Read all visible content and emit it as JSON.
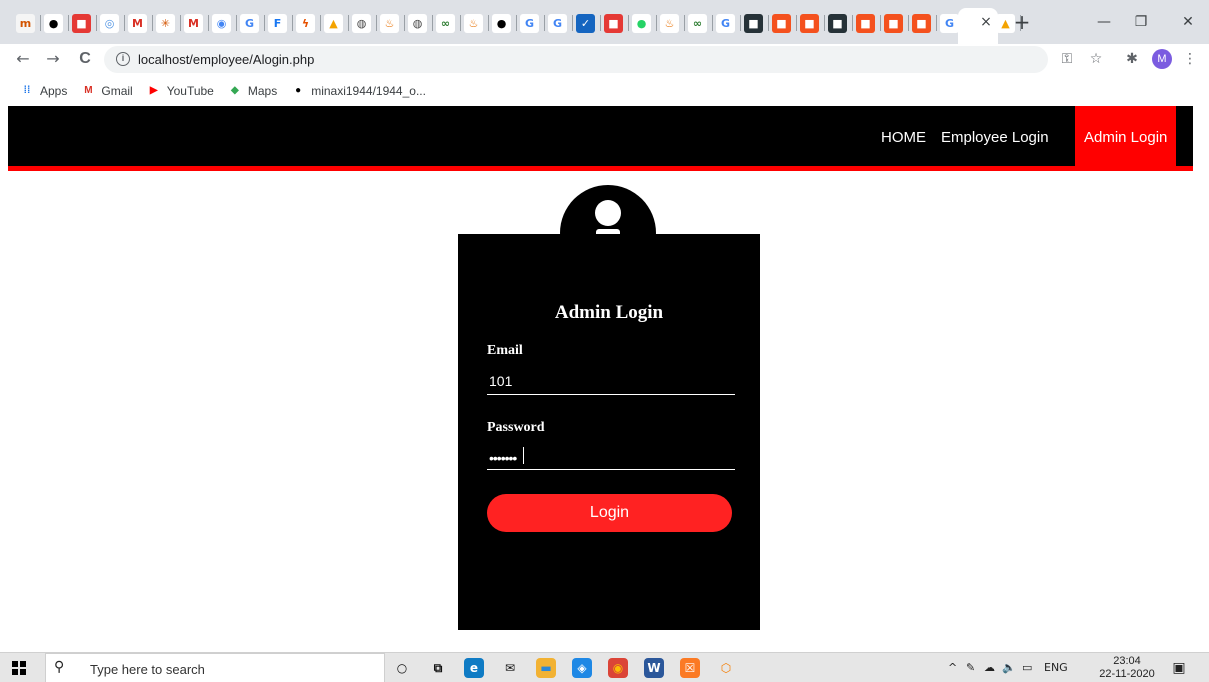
{
  "browser": {
    "tab_favicons": [
      {
        "name": "meta-favicon",
        "glyph": "m",
        "bg": "#f5f5f5",
        "fg": "#d35400"
      },
      {
        "name": "github-favicon",
        "glyph": "●",
        "bg": "#ffffff",
        "fg": "#000000"
      },
      {
        "name": "red-favicon",
        "glyph": "■",
        "bg": "#e53935",
        "fg": "#ffffff"
      },
      {
        "name": "cloud-favicon",
        "glyph": "◎",
        "bg": "#ffffff",
        "fg": "#4a90e2"
      },
      {
        "name": "gmail-favicon",
        "glyph": "M",
        "bg": "#ffffff",
        "fg": "#d93025"
      },
      {
        "name": "atom-favicon",
        "glyph": "✳",
        "bg": "#ffffff",
        "fg": "#d35400"
      },
      {
        "name": "gmail-favicon-2",
        "glyph": "M",
        "bg": "#ffffff",
        "fg": "#d93025"
      },
      {
        "name": "circle-favicon",
        "glyph": "◉",
        "bg": "#ffffff",
        "fg": "#4285f4"
      },
      {
        "name": "google-favicon",
        "glyph": "G",
        "bg": "#ffffff",
        "fg": "#4285f4"
      },
      {
        "name": "facebook-favicon",
        "glyph": "F",
        "bg": "#ffffff",
        "fg": "#1877f2"
      },
      {
        "name": "bolt-favicon",
        "glyph": "ϟ",
        "bg": "#ffffff",
        "fg": "#e65100"
      },
      {
        "name": "phpmyadmin-favicon",
        "glyph": "▲",
        "bg": "#ffffff",
        "fg": "#f4a300"
      },
      {
        "name": "globe-favicon",
        "glyph": "◍",
        "bg": "#ffffff",
        "fg": "#444444"
      },
      {
        "name": "java-favicon",
        "glyph": "♨",
        "bg": "#ffffff",
        "fg": "#e76f00"
      },
      {
        "name": "globe-favicon-2",
        "glyph": "◍",
        "bg": "#ffffff",
        "fg": "#444444"
      },
      {
        "name": "link-favicon",
        "glyph": "∞",
        "bg": "#ffffff",
        "fg": "#2e7d32"
      },
      {
        "name": "java-favicon-2",
        "glyph": "♨",
        "bg": "#ffffff",
        "fg": "#e76f00"
      },
      {
        "name": "github-favicon-2",
        "glyph": "●",
        "bg": "#ffffff",
        "fg": "#000000"
      },
      {
        "name": "google-favicon-2",
        "glyph": "G",
        "bg": "#ffffff",
        "fg": "#4285f4"
      },
      {
        "name": "google-favicon-3",
        "glyph": "G",
        "bg": "#ffffff",
        "fg": "#4285f4"
      },
      {
        "name": "check-favicon",
        "glyph": "✓",
        "bg": "#1565c0",
        "fg": "#ffffff"
      },
      {
        "name": "red-square-favicon",
        "glyph": "■",
        "bg": "#e53935",
        "fg": "#ffffff"
      },
      {
        "name": "whatsapp-favicon",
        "glyph": "●",
        "bg": "#ffffff",
        "fg": "#25d366"
      },
      {
        "name": "java-favicon-3",
        "glyph": "♨",
        "bg": "#ffffff",
        "fg": "#e76f00"
      },
      {
        "name": "link-favicon-2",
        "glyph": "∞",
        "bg": "#ffffff",
        "fg": "#2e7d32"
      },
      {
        "name": "google-favicon-4",
        "glyph": "G",
        "bg": "#ffffff",
        "fg": "#4285f4"
      },
      {
        "name": "dark-square-favicon",
        "glyph": "■",
        "bg": "#263238",
        "fg": "#ffffff"
      },
      {
        "name": "orange-favicon",
        "glyph": "■",
        "bg": "#f4511e",
        "fg": "#ffffff"
      },
      {
        "name": "orange-favicon-2",
        "glyph": "■",
        "bg": "#f4511e",
        "fg": "#ffffff"
      },
      {
        "name": "dark-square-favicon-2",
        "glyph": "■",
        "bg": "#263238",
        "fg": "#ffffff"
      },
      {
        "name": "orange-favicon-3",
        "glyph": "■",
        "bg": "#f4511e",
        "fg": "#ffffff"
      },
      {
        "name": "orange-favicon-4",
        "glyph": "■",
        "bg": "#f4511e",
        "fg": "#ffffff"
      },
      {
        "name": "orange-favicon-5",
        "glyph": "■",
        "bg": "#f4511e",
        "fg": "#ffffff"
      },
      {
        "name": "google-favicon-5",
        "glyph": "G",
        "bg": "#ffffff",
        "fg": "#4285f4"
      },
      {
        "name": "orange-favicon-6",
        "glyph": "■",
        "bg": "#ef6c00",
        "fg": "#ffffff"
      },
      {
        "name": "phpmyadmin-favicon-2",
        "glyph": "▲",
        "bg": "#ffffff",
        "fg": "#f4a300"
      }
    ],
    "close_tab_glyph": "×",
    "new_tab_glyph": "+",
    "minimize_glyph": "—",
    "restore_glyph": "❐",
    "close_window_glyph": "✕",
    "back_glyph": "←",
    "forward_glyph": "→",
    "reload_glyph": "C",
    "info_glyph": "i",
    "url": "localhost/employee/Alogin.php",
    "key_glyph": "⚿",
    "star_glyph": "☆",
    "extensions_glyph": "✱",
    "profile_initial": "M",
    "menu_glyph": "⋮",
    "bookmarks": [
      {
        "name": "apps",
        "label": "Apps",
        "glyph": "⁞⁞",
        "color": "#1a73e8"
      },
      {
        "name": "gmail",
        "label": "Gmail",
        "glyph": "M",
        "color": "#d93025"
      },
      {
        "name": "youtube",
        "label": "YouTube",
        "glyph": "▶",
        "color": "#ff0000"
      },
      {
        "name": "maps",
        "label": "Maps",
        "glyph": "◆",
        "color": "#34a853"
      },
      {
        "name": "github",
        "label": "minaxi1944/1944_o...",
        "glyph": "●",
        "color": "#000000"
      }
    ]
  },
  "site": {
    "nav": {
      "home": "HOME",
      "employee_login": "Employee Login",
      "admin_login": "Admin Login"
    },
    "colors": {
      "nav_bg": "#000000",
      "accent": "#ff0000"
    },
    "form": {
      "title": "Admin Login",
      "email_label": "Email",
      "email_value": "101",
      "password_label": "Password",
      "password_mask": "•••••••",
      "login_label": "Login"
    }
  },
  "taskbar": {
    "search_glyph": "⚲",
    "search_placeholder": "Type here to search",
    "apps": [
      {
        "name": "cortana-icon",
        "glyph": "○",
        "bg": "transparent",
        "fg": "#111111"
      },
      {
        "name": "task-view-icon",
        "glyph": "⧉",
        "bg": "transparent",
        "fg": "#111111"
      },
      {
        "name": "edge-icon",
        "glyph": "e",
        "bg": "#0f7bc4",
        "fg": "#ffffff"
      },
      {
        "name": "mail-icon",
        "glyph": "✉",
        "bg": "transparent",
        "fg": "#111111"
      },
      {
        "name": "file-explorer-icon",
        "glyph": "▬",
        "bg": "#f2b233",
        "fg": "#2b88d8"
      },
      {
        "name": "safari-icon",
        "glyph": "◈",
        "bg": "#1e88e5",
        "fg": "#ffffff"
      },
      {
        "name": "chrome-icon",
        "glyph": "◉",
        "bg": "#db4437",
        "fg": "#fbbc05"
      },
      {
        "name": "word-icon",
        "glyph": "W",
        "bg": "#2b579a",
        "fg": "#ffffff"
      },
      {
        "name": "xampp-icon",
        "glyph": "☒",
        "bg": "#fb7a24",
        "fg": "#ffffff"
      },
      {
        "name": "app-icon",
        "glyph": "⬡",
        "bg": "transparent",
        "fg": "#f57c00"
      }
    ],
    "tray": {
      "chevron": "^",
      "pen": "✎",
      "onedrive": "☁",
      "volume": "🔈",
      "battery": "▭",
      "language": "ENG"
    },
    "time": "23:04",
    "date": "22-11-2020",
    "notification_glyph": "▣"
  }
}
